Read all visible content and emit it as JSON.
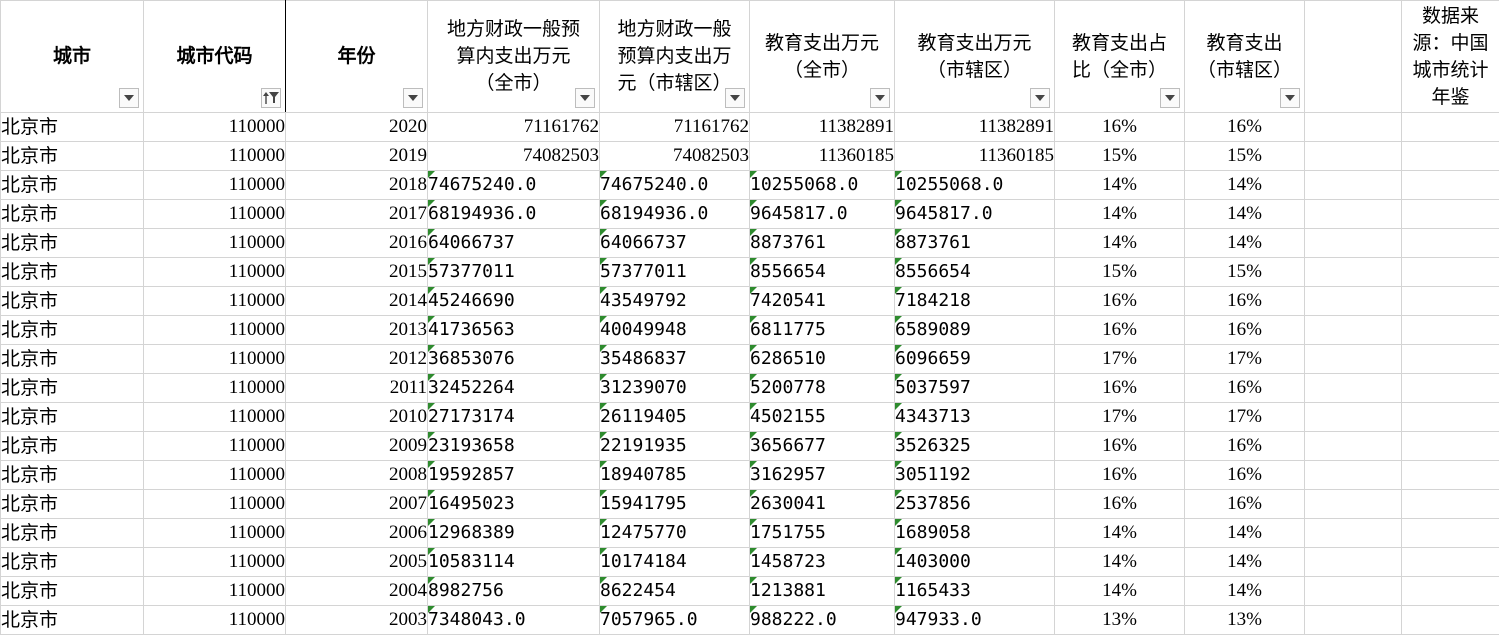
{
  "sheet": {
    "headers": [
      {
        "key": "city",
        "lines": [
          "城市"
        ],
        "bold": true,
        "filter": "dropdown"
      },
      {
        "key": "code",
        "lines": [
          "城市代码"
        ],
        "bold": true,
        "filter": "sort-filter-active"
      },
      {
        "key": "year",
        "lines": [
          "年份"
        ],
        "bold": true,
        "filter": "dropdown"
      },
      {
        "key": "budget_all",
        "lines": [
          "地方财政一般预",
          "算内支出万元",
          "（全市）"
        ],
        "bold": false,
        "filter": "dropdown"
      },
      {
        "key": "budget_dist",
        "lines": [
          "地方财政一般",
          "预算内支出万",
          "元（市辖区）"
        ],
        "bold": false,
        "filter": "dropdown"
      },
      {
        "key": "edu_all",
        "lines": [
          "教育支出万元",
          "（全市）"
        ],
        "bold": false,
        "filter": "dropdown"
      },
      {
        "key": "edu_dist",
        "lines": [
          "教育支出万元",
          "（市辖区）"
        ],
        "bold": false,
        "filter": "dropdown"
      },
      {
        "key": "ratio_all",
        "lines": [
          "教育支出占",
          "比（全市）"
        ],
        "bold": false,
        "filter": "dropdown"
      },
      {
        "key": "ratio_dist",
        "lines": [
          "教育支出",
          "（市辖区）"
        ],
        "bold": false,
        "filter": "dropdown"
      },
      {
        "key": "blank",
        "lines": [
          ""
        ],
        "bold": false,
        "filter": "none"
      },
      {
        "key": "source",
        "lines": [
          "数据来",
          "源：中国",
          "城市统计",
          "年鉴"
        ],
        "bold": false,
        "filter": "none"
      }
    ],
    "rows": [
      {
        "city": "北京市",
        "code": "110000",
        "year": "2020",
        "budget_all": "71161762",
        "budget_dist": "71161762",
        "edu_all": "11382891",
        "edu_dist": "11382891",
        "ratio_all": "16%",
        "ratio_dist": "16%",
        "text_cells": false
      },
      {
        "city": "北京市",
        "code": "110000",
        "year": "2019",
        "budget_all": "74082503",
        "budget_dist": "74082503",
        "edu_all": "11360185",
        "edu_dist": "11360185",
        "ratio_all": "15%",
        "ratio_dist": "15%",
        "text_cells": false
      },
      {
        "city": "北京市",
        "code": "110000",
        "year": "2018",
        "budget_all": "74675240.0",
        "budget_dist": "74675240.0",
        "edu_all": "10255068.0",
        "edu_dist": "10255068.0",
        "ratio_all": "14%",
        "ratio_dist": "14%",
        "text_cells": true
      },
      {
        "city": "北京市",
        "code": "110000",
        "year": "2017",
        "budget_all": "68194936.0",
        "budget_dist": "68194936.0",
        "edu_all": "9645817.0",
        "edu_dist": "9645817.0",
        "ratio_all": "14%",
        "ratio_dist": "14%",
        "text_cells": true
      },
      {
        "city": "北京市",
        "code": "110000",
        "year": "2016",
        "budget_all": "64066737",
        "budget_dist": "64066737",
        "edu_all": "8873761",
        "edu_dist": "8873761",
        "ratio_all": "14%",
        "ratio_dist": "14%",
        "text_cells": true
      },
      {
        "city": "北京市",
        "code": "110000",
        "year": "2015",
        "budget_all": "57377011",
        "budget_dist": "57377011",
        "edu_all": "8556654",
        "edu_dist": "8556654",
        "ratio_all": "15%",
        "ratio_dist": "15%",
        "text_cells": true
      },
      {
        "city": "北京市",
        "code": "110000",
        "year": "2014",
        "budget_all": "45246690",
        "budget_dist": "43549792",
        "edu_all": "7420541",
        "edu_dist": "7184218",
        "ratio_all": "16%",
        "ratio_dist": "16%",
        "text_cells": true
      },
      {
        "city": "北京市",
        "code": "110000",
        "year": "2013",
        "budget_all": "41736563",
        "budget_dist": "40049948",
        "edu_all": "6811775",
        "edu_dist": "6589089",
        "ratio_all": "16%",
        "ratio_dist": "16%",
        "text_cells": true
      },
      {
        "city": "北京市",
        "code": "110000",
        "year": "2012",
        "budget_all": "36853076",
        "budget_dist": "35486837",
        "edu_all": "6286510",
        "edu_dist": "6096659",
        "ratio_all": "17%",
        "ratio_dist": "17%",
        "text_cells": true
      },
      {
        "city": "北京市",
        "code": "110000",
        "year": "2011",
        "budget_all": "32452264",
        "budget_dist": "31239070",
        "edu_all": "5200778",
        "edu_dist": "5037597",
        "ratio_all": "16%",
        "ratio_dist": "16%",
        "text_cells": true
      },
      {
        "city": "北京市",
        "code": "110000",
        "year": "2010",
        "budget_all": "27173174",
        "budget_dist": "26119405",
        "edu_all": "4502155",
        "edu_dist": "4343713",
        "ratio_all": "17%",
        "ratio_dist": "17%",
        "text_cells": true
      },
      {
        "city": "北京市",
        "code": "110000",
        "year": "2009",
        "budget_all": "23193658",
        "budget_dist": "22191935",
        "edu_all": "3656677",
        "edu_dist": "3526325",
        "ratio_all": "16%",
        "ratio_dist": "16%",
        "text_cells": true
      },
      {
        "city": "北京市",
        "code": "110000",
        "year": "2008",
        "budget_all": "19592857",
        "budget_dist": "18940785",
        "edu_all": "3162957",
        "edu_dist": "3051192",
        "ratio_all": "16%",
        "ratio_dist": "16%",
        "text_cells": true
      },
      {
        "city": "北京市",
        "code": "110000",
        "year": "2007",
        "budget_all": "16495023",
        "budget_dist": "15941795",
        "edu_all": "2630041",
        "edu_dist": "2537856",
        "ratio_all": "16%",
        "ratio_dist": "16%",
        "text_cells": true
      },
      {
        "city": "北京市",
        "code": "110000",
        "year": "2006",
        "budget_all": "12968389",
        "budget_dist": "12475770",
        "edu_all": "1751755",
        "edu_dist": "1689058",
        "ratio_all": "14%",
        "ratio_dist": "14%",
        "text_cells": true
      },
      {
        "city": "北京市",
        "code": "110000",
        "year": "2005",
        "budget_all": "10583114",
        "budget_dist": "10174184",
        "edu_all": "1458723",
        "edu_dist": "1403000",
        "ratio_all": "14%",
        "ratio_dist": "14%",
        "text_cells": true
      },
      {
        "city": "北京市",
        "code": "110000",
        "year": "2004",
        "budget_all": "8982756",
        "budget_dist": "8622454",
        "edu_all": "1213881",
        "edu_dist": "1165433",
        "ratio_all": "14%",
        "ratio_dist": "14%",
        "text_cells": true
      },
      {
        "city": "北京市",
        "code": "110000",
        "year": "2003",
        "budget_all": "7348043.0",
        "budget_dist": "7057965.0",
        "edu_all": "988222.0",
        "edu_dist": "947933.0",
        "ratio_all": "13%",
        "ratio_dist": "13%",
        "text_cells": true
      }
    ]
  },
  "colors": {
    "gridline": "#d4d4d4",
    "text_number_indicator": "#2e8b2e",
    "filter_arrow": "#444444"
  }
}
